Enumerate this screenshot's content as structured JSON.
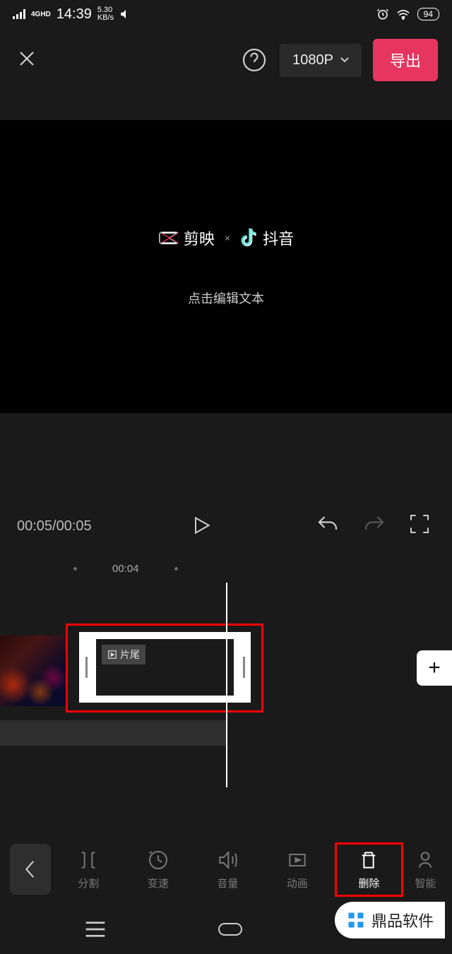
{
  "status": {
    "net": "4GHD",
    "time": "14:39",
    "speed_top": "5.30",
    "speed_bot": "KB/s",
    "battery": "94"
  },
  "toolbar": {
    "resolution": "1080P",
    "export": "导出"
  },
  "preview": {
    "app1": "剪映",
    "app2": "抖音",
    "hint": "点击编辑文本"
  },
  "controls": {
    "time": "00:05/00:05"
  },
  "ruler": {
    "mark": "00:04"
  },
  "timeline": {
    "end_tag": "片尾"
  },
  "tools": [
    {
      "label": "分割"
    },
    {
      "label": "变速"
    },
    {
      "label": "音量"
    },
    {
      "label": "动画"
    },
    {
      "label": "删除"
    },
    {
      "label": "智能"
    }
  ],
  "watermark": "鼎品软件"
}
